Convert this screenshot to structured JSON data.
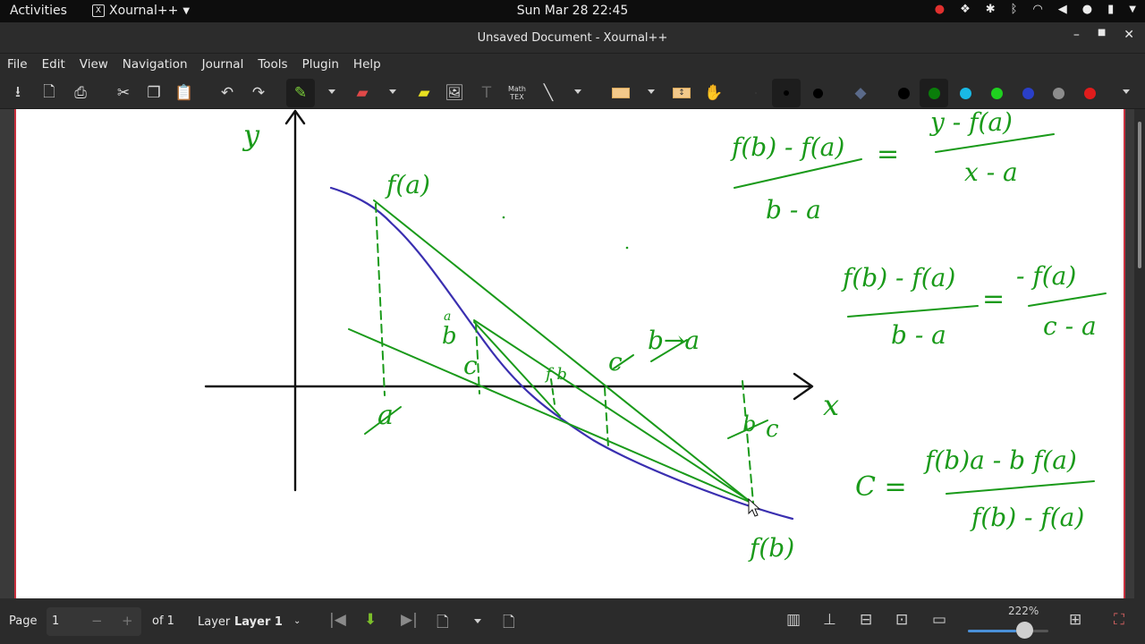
{
  "topbar": {
    "activities": "Activities",
    "app_name": "Xournal++",
    "clock": "Sun Mar 28  22:45"
  },
  "window": {
    "title": "Unsaved Document - Xournal++"
  },
  "menu": {
    "file": "File",
    "edit": "Edit",
    "view": "View",
    "navigation": "Navigation",
    "journal": "Journal",
    "tools": "Tools",
    "plugin": "Plugin",
    "help": "Help"
  },
  "toolbar": {
    "math_tex_label": "Math TEX",
    "active_tool": "pen",
    "pen_color": "#1e9e1e",
    "palette": [
      "#000000",
      "#0a7d0a",
      "#19b9e6",
      "#1fd01f",
      "#2a3fc8",
      "#8c8c8c",
      "#e01c1c"
    ]
  },
  "canvas": {
    "ink_color": "#1a9a1a",
    "curve_color": "#3a2fb0",
    "axis_color": "#111111",
    "notes": {
      "y_axis": "y",
      "x_axis": "x",
      "fa_top": "f(a)",
      "fb_bottom": "f(b)",
      "a_tick": "a",
      "b_tick": "b",
      "c_point": "c",
      "b_to_a": "b→a",
      "c_to_b": "c",
      "fb_small": "f b",
      "b_a_label": "b",
      "c_a_label": "c",
      "b_under": "a"
    },
    "equations": {
      "eq1_num": "f(b) - f(a)",
      "eq1_den": "b - a",
      "eq1_eq": "=",
      "eq1_rnum": "y - f(a)",
      "eq1_rden": "x - a",
      "eq2_num": "f(b) - f(a)",
      "eq2_den": "b - a",
      "eq2_eq": "=",
      "eq2_rnum": "- f(a)",
      "eq2_rden": "c - a",
      "eq3_lhs": "C  =",
      "eq3_num": "f(b)a - b f(a)",
      "eq3_den": "f(b) - f(a)"
    }
  },
  "statusbar": {
    "page_label": "Page",
    "page_value": "1",
    "minus": "−",
    "plus": "+",
    "of_label": "of 1",
    "layer_label": "Layer",
    "layer_value": "Layer 1",
    "zoom": "222%",
    "zoom_fraction": 0.6
  }
}
